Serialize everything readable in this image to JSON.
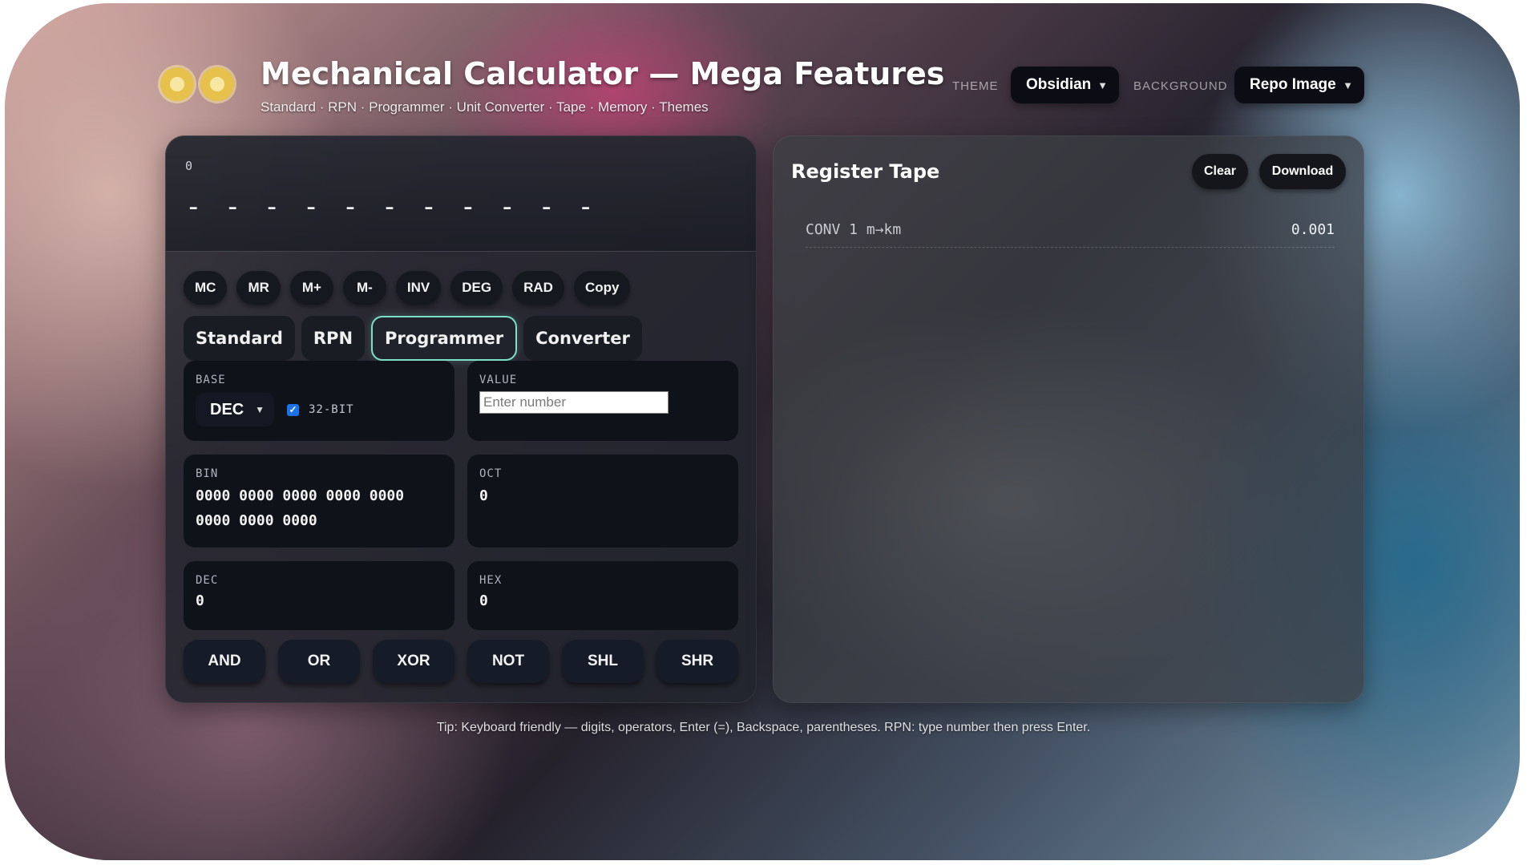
{
  "header": {
    "title": "Mechanical Calculator — Mega Features",
    "subtitle": "Standard · RPN · Programmer · Unit Converter · Tape · Memory · Themes",
    "theme_label": "THEME",
    "theme_value": "Obsidian",
    "background_label": "BACKGROUND",
    "background_value": "Repo Image"
  },
  "display": {
    "expression": "0",
    "main": "- - - - - - - - - - -"
  },
  "memory_buttons": [
    "MC",
    "MR",
    "M+",
    "M-",
    "INV",
    "DEG",
    "RAD",
    "Copy"
  ],
  "tabs": [
    "Standard",
    "RPN",
    "Programmer",
    "Converter"
  ],
  "active_tab": "Programmer",
  "programmer": {
    "base_label": "BASE",
    "base_value": "DEC",
    "bit_label": "32-BIT",
    "bit_checked": true,
    "value_label": "VALUE",
    "value_placeholder": "Enter number",
    "bin_label": "BIN",
    "bin_value": "0000 0000 0000 0000 0000 0000 0000 0000",
    "oct_label": "OCT",
    "oct_value": "0",
    "dec_label": "DEC",
    "dec_value": "0",
    "hex_label": "HEX",
    "hex_value": "0",
    "ops": [
      "AND",
      "OR",
      "XOR",
      "NOT",
      "SHL",
      "SHR"
    ]
  },
  "tape": {
    "title": "Register Tape",
    "clear_label": "Clear",
    "download_label": "Download",
    "entries": [
      {
        "expr": "CONV 1 m→km",
        "result": "0.001"
      }
    ]
  },
  "footer": {
    "tip": "Tip: Keyboard friendly — digits, operators, Enter (=), Backspace, parentheses. RPN: type number then press Enter."
  },
  "colors": {
    "accent": "#7be0c6",
    "panel_dark": "#10121a",
    "checkbox": "#1a73e8"
  }
}
